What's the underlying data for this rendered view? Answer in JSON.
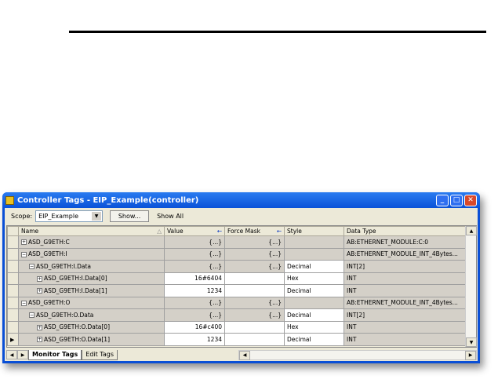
{
  "window": {
    "title": "Controller Tags - EIP_Example(controller)"
  },
  "toolbar": {
    "scope_label": "Scope:",
    "scope_value": "EIP_Example",
    "show_button": "Show...",
    "show_filter": "Show All"
  },
  "columns": [
    "Name",
    "Value",
    "Force Mask",
    "Style",
    "Data Type"
  ],
  "rows": [
    {
      "indent": 0,
      "expander": "+",
      "name": "ASD_G9ETH:C",
      "value": "{...}",
      "force": "{...}",
      "style": "",
      "type": "AB:ETHERNET_MODULE:C:0"
    },
    {
      "indent": 0,
      "expander": "−",
      "name": "ASD_G9ETH:I",
      "value": "{...}",
      "force": "{...}",
      "style": "",
      "type": "AB:ETHERNET_MODULE_INT_4Bytes..."
    },
    {
      "indent": 1,
      "expander": "−",
      "name": "ASD_G9ETH:I.Data",
      "value": "{...}",
      "force": "{...}",
      "style": "Decimal",
      "type": "INT[2]"
    },
    {
      "indent": 2,
      "expander": "+",
      "name": "ASD_G9ETH:I.Data[0]",
      "value": "16#6404",
      "force": "",
      "style": "Hex",
      "type": "INT"
    },
    {
      "indent": 2,
      "expander": "+",
      "name": "ASD_G9ETH:I.Data[1]",
      "value": "1234",
      "force": "",
      "style": "Decimal",
      "type": "INT"
    },
    {
      "indent": 0,
      "expander": "−",
      "name": "ASD_G9ETH:O",
      "value": "{...}",
      "force": "{...}",
      "style": "",
      "type": "AB:ETHERNET_MODULE_INT_4Bytes..."
    },
    {
      "indent": 1,
      "expander": "−",
      "name": "ASD_G9ETH:O.Data",
      "value": "{...}",
      "force": "{...}",
      "style": "Decimal",
      "type": "INT[2]"
    },
    {
      "indent": 2,
      "expander": "+",
      "name": "ASD_G9ETH:O.Data[0]",
      "value": "16#c400",
      "force": "",
      "style": "Hex",
      "type": "INT"
    },
    {
      "indent": 2,
      "expander": "+",
      "name": "ASD_G9ETH:O.Data[1]",
      "value": "1234",
      "force": "",
      "style": "Decimal",
      "type": "INT",
      "current": true
    }
  ],
  "tabs": [
    "Monitor Tags",
    "Edit Tags"
  ]
}
